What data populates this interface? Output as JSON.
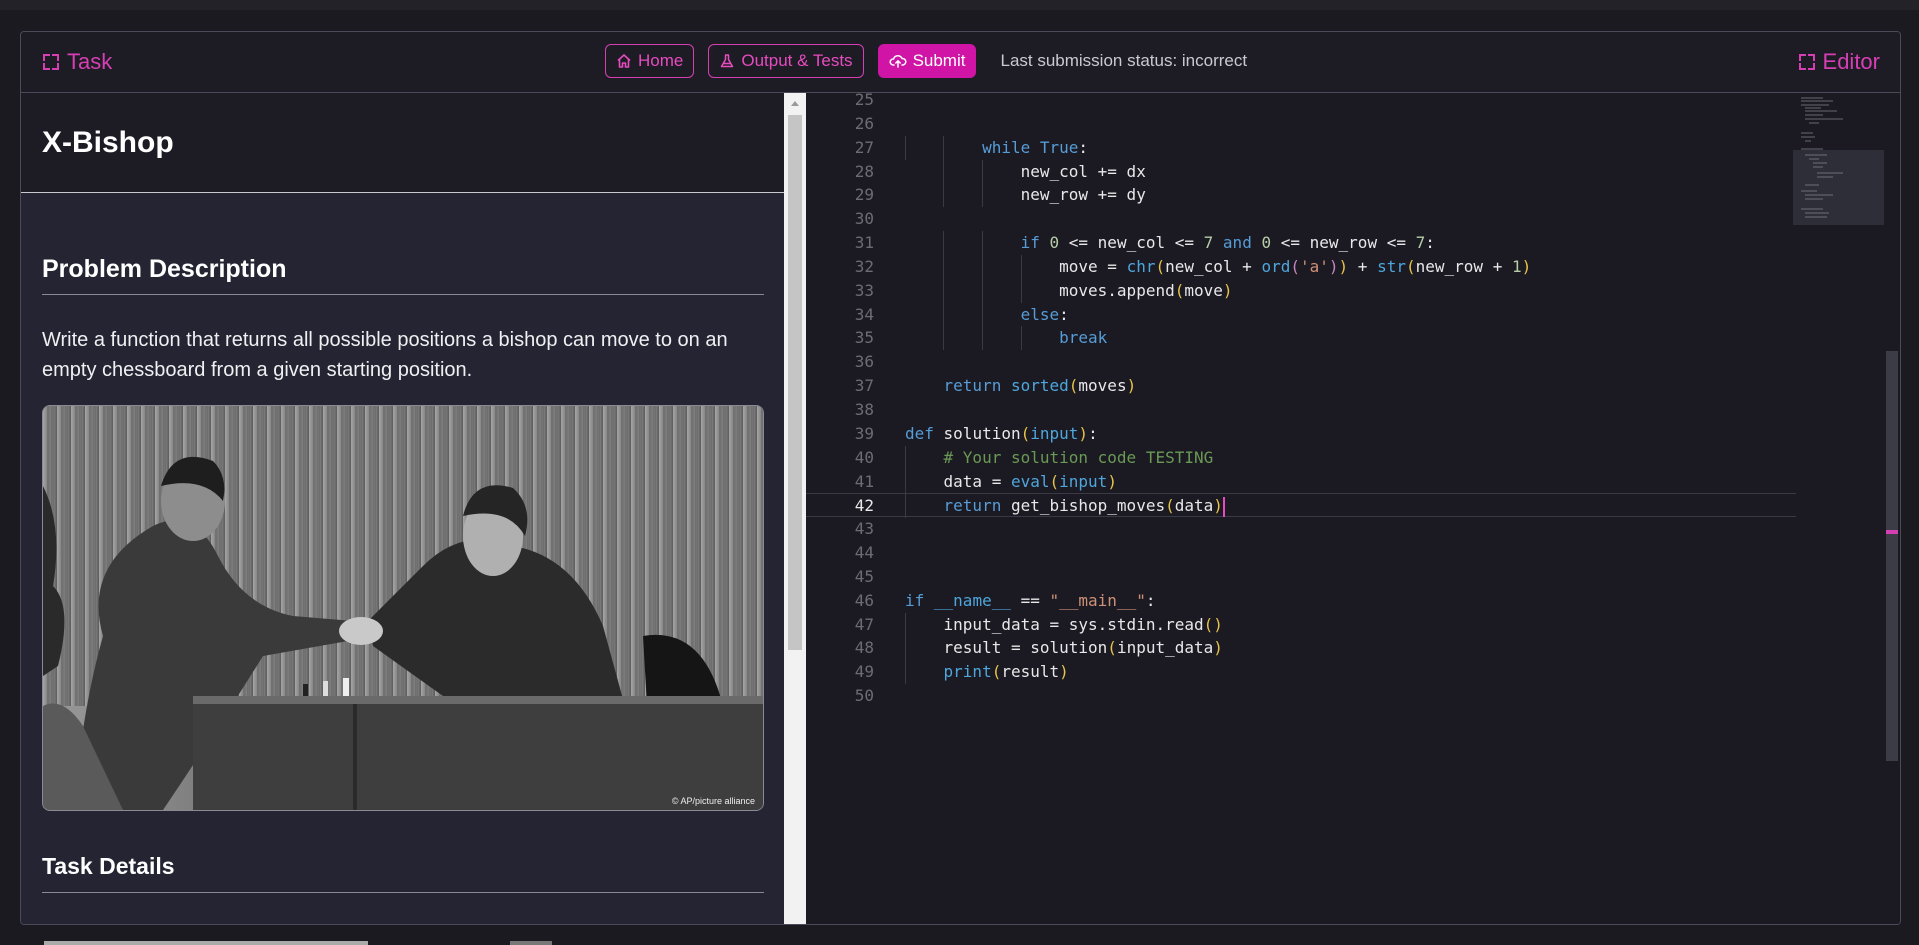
{
  "header": {
    "task_label": "Task",
    "editor_label": "Editor",
    "home_label": "Home",
    "output_label": "Output & Tests",
    "submit_label": "Submit",
    "status_text": "Last submission status: incorrect"
  },
  "task": {
    "title": "X-Bishop",
    "section_problem": "Problem Description",
    "description": "Write a function that returns all possible positions a bishop can move to on an empty chessboard from a given starting position.",
    "photo_credit": "© AP/picture alliance",
    "section_details": "Task Details"
  },
  "editor": {
    "active_line": 42,
    "line_numbers": [
      "25",
      "26",
      "27",
      "28",
      "29",
      "30",
      "31",
      "32",
      "33",
      "34",
      "35",
      "36",
      "37",
      "38",
      "39",
      "40",
      "41",
      "42",
      "43",
      "44",
      "45",
      "46",
      "47",
      "48",
      "49",
      "50"
    ]
  },
  "colors": {
    "accent": "#d63fb3",
    "submit_bg": "#d015a6",
    "background": "#1d1c25"
  }
}
